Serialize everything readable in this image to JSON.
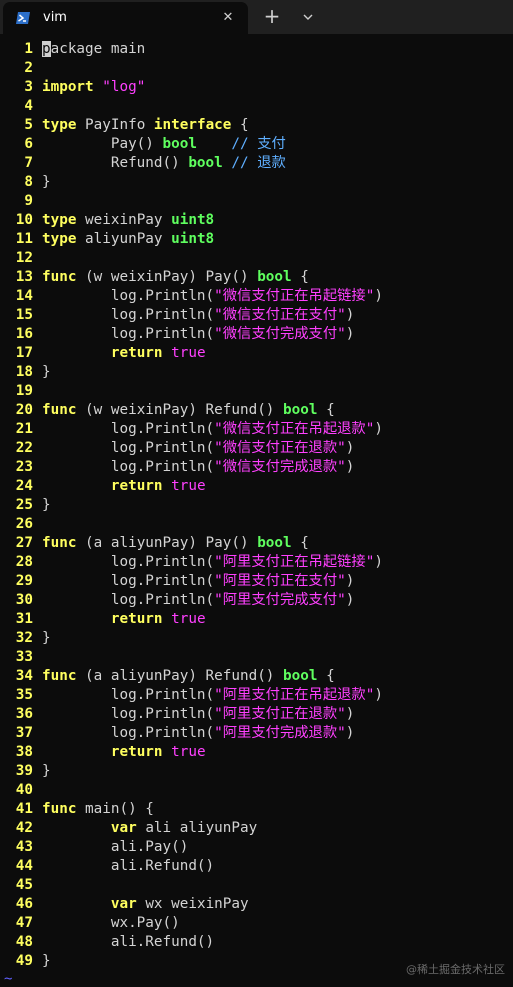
{
  "window": {
    "tab_title": "vim",
    "tab_icon": "powershell-icon",
    "close_glyph": "✕",
    "new_tab_glyph": "+",
    "dropdown_icon": "chevron-down-icon"
  },
  "colors": {
    "background": "#0c0c0c",
    "line_number": "#ffff60",
    "keyword": "#ffff5f",
    "type": "#5fff5f",
    "string": "#ff40ff",
    "comment": "#5fafff",
    "text": "#d4d4d4"
  },
  "editor": {
    "lines": [
      {
        "n": "1",
        "segs": [
          {
            "t": "p",
            "c": "cursor"
          },
          {
            "t": "ackage main",
            "c": ""
          }
        ]
      },
      {
        "n": "2",
        "segs": []
      },
      {
        "n": "3",
        "segs": [
          {
            "t": "import ",
            "c": "kw"
          },
          {
            "t": "\"log\"",
            "c": "str"
          }
        ]
      },
      {
        "n": "4",
        "segs": []
      },
      {
        "n": "5",
        "segs": [
          {
            "t": "type ",
            "c": "kw"
          },
          {
            "t": "PayInfo ",
            "c": ""
          },
          {
            "t": "interface",
            "c": "kw"
          },
          {
            "t": " {",
            "c": ""
          }
        ]
      },
      {
        "n": "6",
        "segs": [
          {
            "t": "        Pay() ",
            "c": ""
          },
          {
            "t": "bool",
            "c": "tp"
          },
          {
            "t": "    // 支付",
            "c": "cm"
          }
        ]
      },
      {
        "n": "7",
        "segs": [
          {
            "t": "        Refund() ",
            "c": ""
          },
          {
            "t": "bool",
            "c": "tp"
          },
          {
            "t": " // 退款",
            "c": "cm"
          }
        ]
      },
      {
        "n": "8",
        "segs": [
          {
            "t": "}",
            "c": ""
          }
        ]
      },
      {
        "n": "9",
        "segs": []
      },
      {
        "n": "10",
        "segs": [
          {
            "t": "type ",
            "c": "kw"
          },
          {
            "t": "weixinPay ",
            "c": ""
          },
          {
            "t": "uint8",
            "c": "tp"
          }
        ]
      },
      {
        "n": "11",
        "segs": [
          {
            "t": "type ",
            "c": "kw"
          },
          {
            "t": "aliyunPay ",
            "c": ""
          },
          {
            "t": "uint8",
            "c": "tp"
          }
        ]
      },
      {
        "n": "12",
        "segs": []
      },
      {
        "n": "13",
        "segs": [
          {
            "t": "func ",
            "c": "kw"
          },
          {
            "t": "(w weixinPay) Pay() ",
            "c": ""
          },
          {
            "t": "bool",
            "c": "tp"
          },
          {
            "t": " {",
            "c": ""
          }
        ]
      },
      {
        "n": "14",
        "segs": [
          {
            "t": "        log.Println(",
            "c": ""
          },
          {
            "t": "\"微信支付正在吊起链接\"",
            "c": "str"
          },
          {
            "t": ")",
            "c": ""
          }
        ]
      },
      {
        "n": "15",
        "segs": [
          {
            "t": "        log.Println(",
            "c": ""
          },
          {
            "t": "\"微信支付正在支付\"",
            "c": "str"
          },
          {
            "t": ")",
            "c": ""
          }
        ]
      },
      {
        "n": "16",
        "segs": [
          {
            "t": "        log.Println(",
            "c": ""
          },
          {
            "t": "\"微信支付完成支付\"",
            "c": "str"
          },
          {
            "t": ")",
            "c": ""
          }
        ]
      },
      {
        "n": "17",
        "segs": [
          {
            "t": "        ",
            "c": ""
          },
          {
            "t": "return ",
            "c": "kw"
          },
          {
            "t": "true",
            "c": "bool"
          }
        ]
      },
      {
        "n": "18",
        "segs": [
          {
            "t": "}",
            "c": ""
          }
        ]
      },
      {
        "n": "19",
        "segs": []
      },
      {
        "n": "20",
        "segs": [
          {
            "t": "func ",
            "c": "kw"
          },
          {
            "t": "(w weixinPay) Refund() ",
            "c": ""
          },
          {
            "t": "bool",
            "c": "tp"
          },
          {
            "t": " {",
            "c": ""
          }
        ]
      },
      {
        "n": "21",
        "segs": [
          {
            "t": "        log.Println(",
            "c": ""
          },
          {
            "t": "\"微信支付正在吊起退款\"",
            "c": "str"
          },
          {
            "t": ")",
            "c": ""
          }
        ]
      },
      {
        "n": "22",
        "segs": [
          {
            "t": "        log.Println(",
            "c": ""
          },
          {
            "t": "\"微信支付正在退款\"",
            "c": "str"
          },
          {
            "t": ")",
            "c": ""
          }
        ]
      },
      {
        "n": "23",
        "segs": [
          {
            "t": "        log.Println(",
            "c": ""
          },
          {
            "t": "\"微信支付完成退款\"",
            "c": "str"
          },
          {
            "t": ")",
            "c": ""
          }
        ]
      },
      {
        "n": "24",
        "segs": [
          {
            "t": "        ",
            "c": ""
          },
          {
            "t": "return ",
            "c": "kw"
          },
          {
            "t": "true",
            "c": "bool"
          }
        ]
      },
      {
        "n": "25",
        "segs": [
          {
            "t": "}",
            "c": ""
          }
        ]
      },
      {
        "n": "26",
        "segs": []
      },
      {
        "n": "27",
        "segs": [
          {
            "t": "func ",
            "c": "kw"
          },
          {
            "t": "(a aliyunPay) Pay() ",
            "c": ""
          },
          {
            "t": "bool",
            "c": "tp"
          },
          {
            "t": " {",
            "c": ""
          }
        ]
      },
      {
        "n": "28",
        "segs": [
          {
            "t": "        log.Println(",
            "c": ""
          },
          {
            "t": "\"阿里支付正在吊起链接\"",
            "c": "str"
          },
          {
            "t": ")",
            "c": ""
          }
        ]
      },
      {
        "n": "29",
        "segs": [
          {
            "t": "        log.Println(",
            "c": ""
          },
          {
            "t": "\"阿里支付正在支付\"",
            "c": "str"
          },
          {
            "t": ")",
            "c": ""
          }
        ]
      },
      {
        "n": "30",
        "segs": [
          {
            "t": "        log.Println(",
            "c": ""
          },
          {
            "t": "\"阿里支付完成支付\"",
            "c": "str"
          },
          {
            "t": ")",
            "c": ""
          }
        ]
      },
      {
        "n": "31",
        "segs": [
          {
            "t": "        ",
            "c": ""
          },
          {
            "t": "return ",
            "c": "kw"
          },
          {
            "t": "true",
            "c": "bool"
          }
        ]
      },
      {
        "n": "32",
        "segs": [
          {
            "t": "}",
            "c": ""
          }
        ]
      },
      {
        "n": "33",
        "segs": []
      },
      {
        "n": "34",
        "segs": [
          {
            "t": "func ",
            "c": "kw"
          },
          {
            "t": "(a aliyunPay) Refund() ",
            "c": ""
          },
          {
            "t": "bool",
            "c": "tp"
          },
          {
            "t": " {",
            "c": ""
          }
        ]
      },
      {
        "n": "35",
        "segs": [
          {
            "t": "        log.Println(",
            "c": ""
          },
          {
            "t": "\"阿里支付正在吊起退款\"",
            "c": "str"
          },
          {
            "t": ")",
            "c": ""
          }
        ]
      },
      {
        "n": "36",
        "segs": [
          {
            "t": "        log.Println(",
            "c": ""
          },
          {
            "t": "\"阿里支付正在退款\"",
            "c": "str"
          },
          {
            "t": ")",
            "c": ""
          }
        ]
      },
      {
        "n": "37",
        "segs": [
          {
            "t": "        log.Println(",
            "c": ""
          },
          {
            "t": "\"阿里支付完成退款\"",
            "c": "str"
          },
          {
            "t": ")",
            "c": ""
          }
        ]
      },
      {
        "n": "38",
        "segs": [
          {
            "t": "        ",
            "c": ""
          },
          {
            "t": "return ",
            "c": "kw"
          },
          {
            "t": "true",
            "c": "bool"
          }
        ]
      },
      {
        "n": "39",
        "segs": [
          {
            "t": "}",
            "c": ""
          }
        ]
      },
      {
        "n": "40",
        "segs": []
      },
      {
        "n": "41",
        "segs": [
          {
            "t": "func ",
            "c": "kw"
          },
          {
            "t": "main() {",
            "c": ""
          }
        ]
      },
      {
        "n": "42",
        "segs": [
          {
            "t": "        ",
            "c": ""
          },
          {
            "t": "var ",
            "c": "kw"
          },
          {
            "t": "ali aliyunPay",
            "c": ""
          }
        ]
      },
      {
        "n": "43",
        "segs": [
          {
            "t": "        ali.Pay()",
            "c": ""
          }
        ]
      },
      {
        "n": "44",
        "segs": [
          {
            "t": "        ali.Refund()",
            "c": ""
          }
        ]
      },
      {
        "n": "45",
        "segs": []
      },
      {
        "n": "46",
        "segs": [
          {
            "t": "        ",
            "c": ""
          },
          {
            "t": "var ",
            "c": "kw"
          },
          {
            "t": "wx weixinPay",
            "c": ""
          }
        ]
      },
      {
        "n": "47",
        "segs": [
          {
            "t": "        wx.Pay()",
            "c": ""
          }
        ]
      },
      {
        "n": "48",
        "segs": [
          {
            "t": "        ali.Refund()",
            "c": ""
          }
        ]
      },
      {
        "n": "49",
        "segs": [
          {
            "t": "}",
            "c": ""
          }
        ]
      }
    ],
    "tilde": "~"
  },
  "watermark": "@稀土掘金技术社区"
}
